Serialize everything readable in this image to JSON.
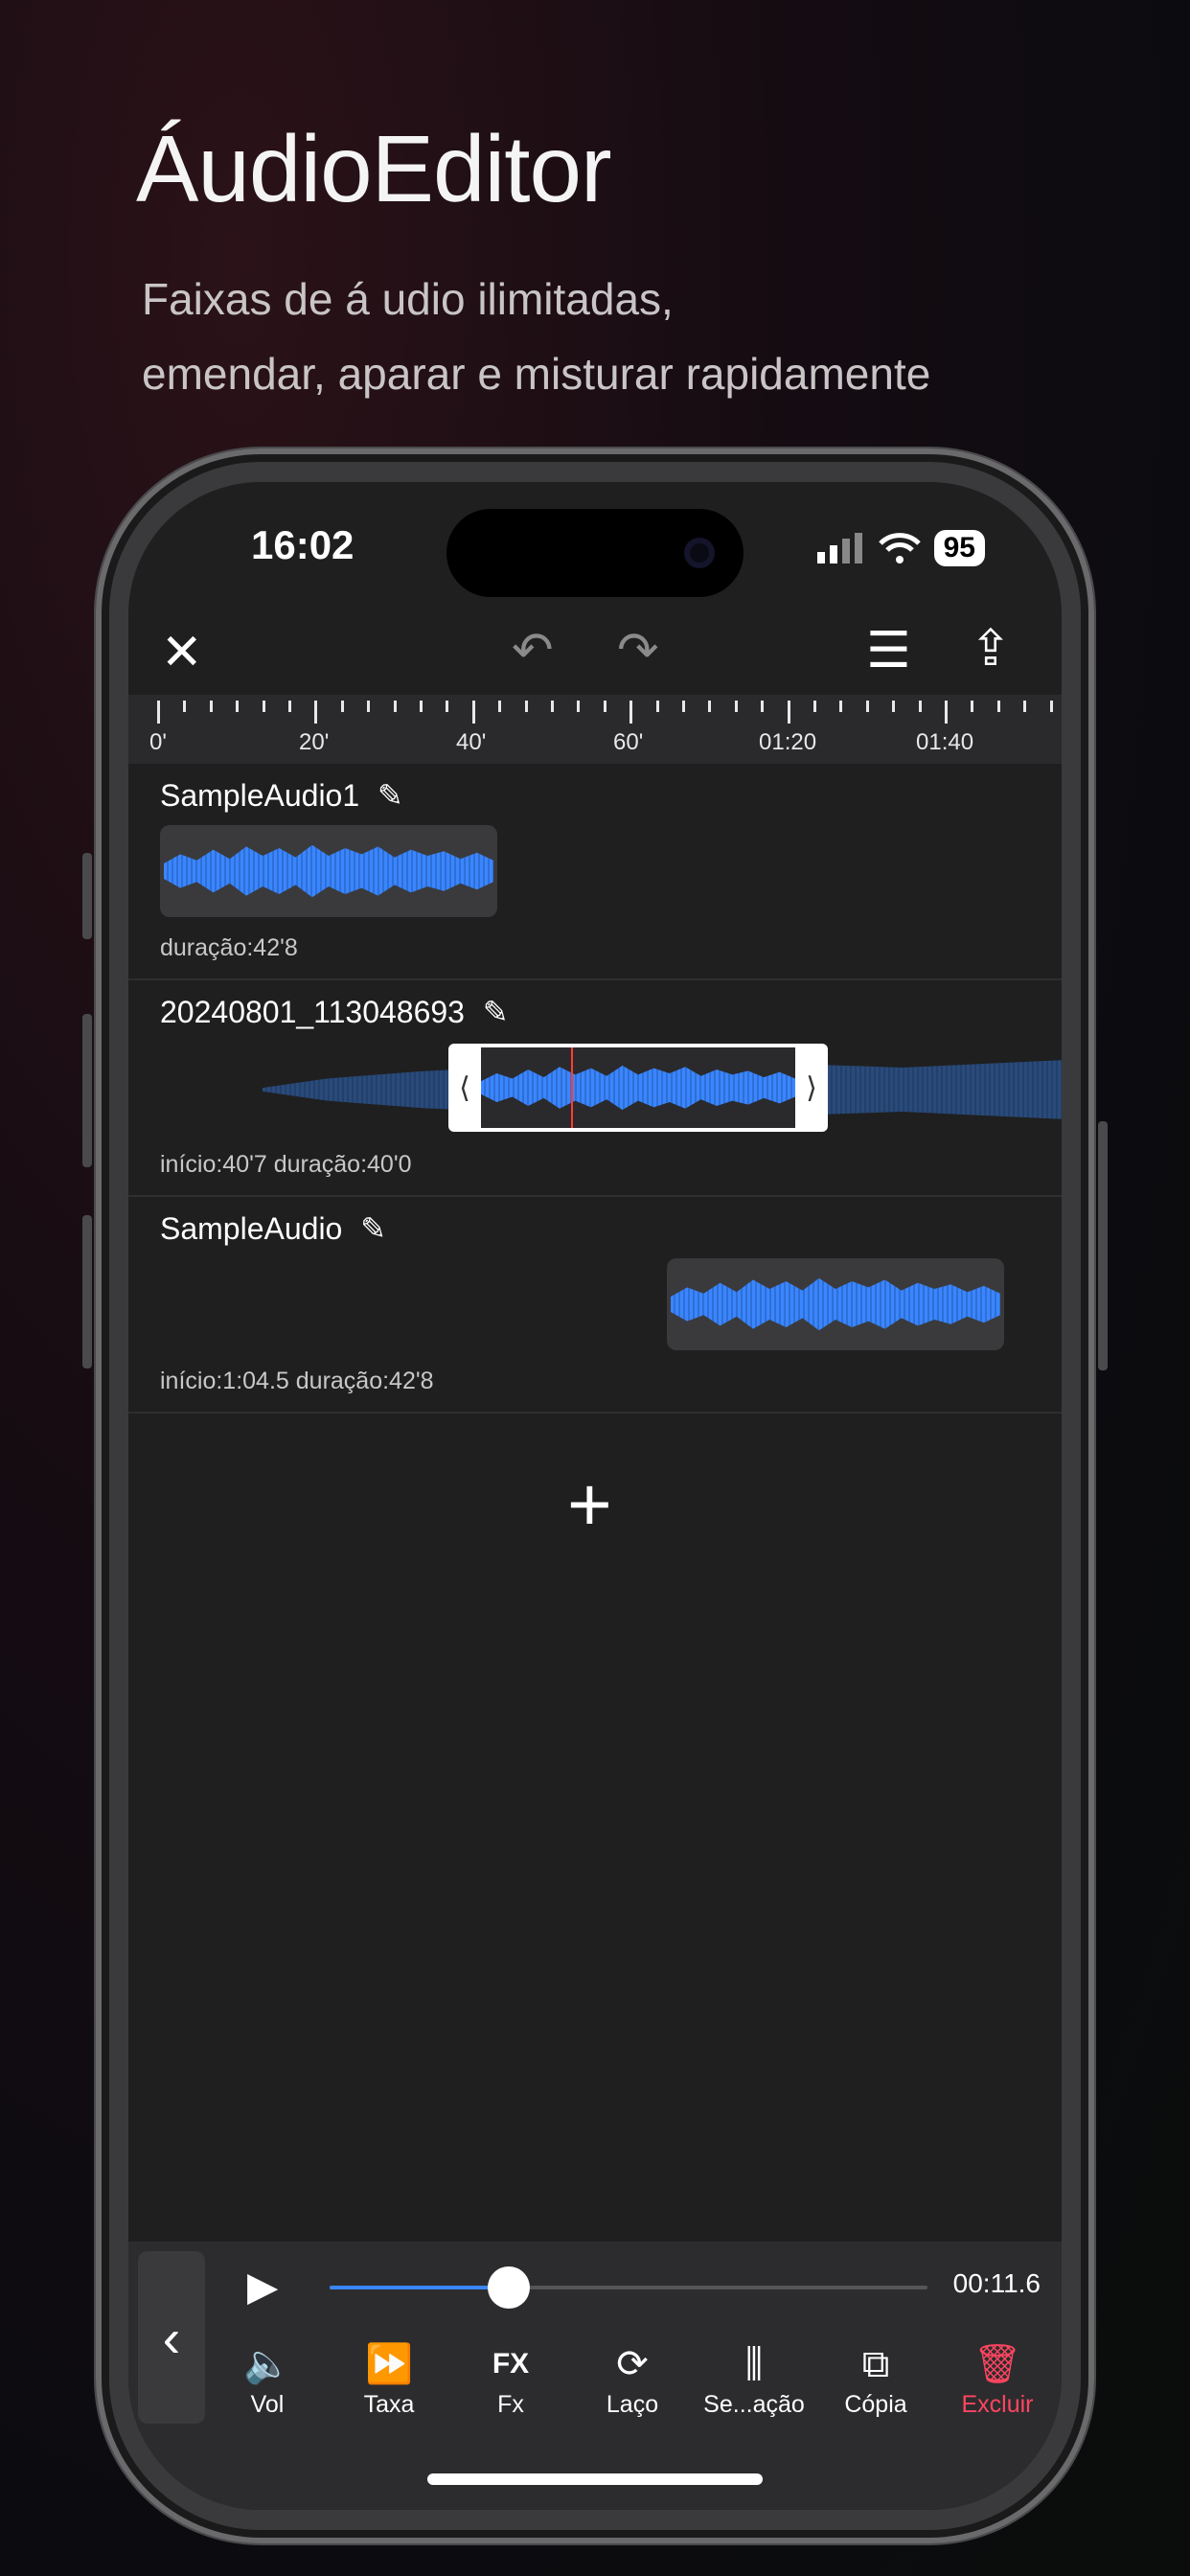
{
  "headline": "ÁudioEditor",
  "subline1": "Faixas de  á udio ilimitadas,",
  "subline2": "emendar, aparar e misturar rapidamente",
  "status": {
    "time": "16:02",
    "battery": "95"
  },
  "toolbar": {
    "close_icon": "✕",
    "undo_icon": "↶",
    "redo_icon": "↷",
    "menu_icon": "☰",
    "share_icon": "⇪"
  },
  "ruler": {
    "labels": [
      "0'",
      "20'",
      "40'",
      "60'",
      "01:20",
      "01:40"
    ]
  },
  "tracks": [
    {
      "name": "SampleAudio1",
      "meta": "duração:42'8"
    },
    {
      "name": "20240801_113048693",
      "meta": "início:40'7  duração:40'0"
    },
    {
      "name": "SampleAudio",
      "meta": "início:1:04.5  duração:42'8"
    }
  ],
  "edit_icon": "✎",
  "add_icon": "+",
  "player": {
    "elapsed": "00:11.6",
    "progress_fraction": 0.3,
    "play_icon": "▶",
    "back_icon": "‹"
  },
  "tools": [
    {
      "label": "Vol",
      "icon": "🔈"
    },
    {
      "label": "Taxa",
      "icon": "⏩"
    },
    {
      "label": "Fx",
      "icon": "FX"
    },
    {
      "label": "Laço",
      "icon": "⟳"
    },
    {
      "label": "Se...ação",
      "icon": "⫼"
    },
    {
      "label": "Cópia",
      "icon": "⧉"
    },
    {
      "label": "Excluir",
      "icon": "🗑"
    }
  ],
  "colors": {
    "accent": "#3a86ff",
    "danger": "#ff4560",
    "playhead": "#ff3b30"
  }
}
